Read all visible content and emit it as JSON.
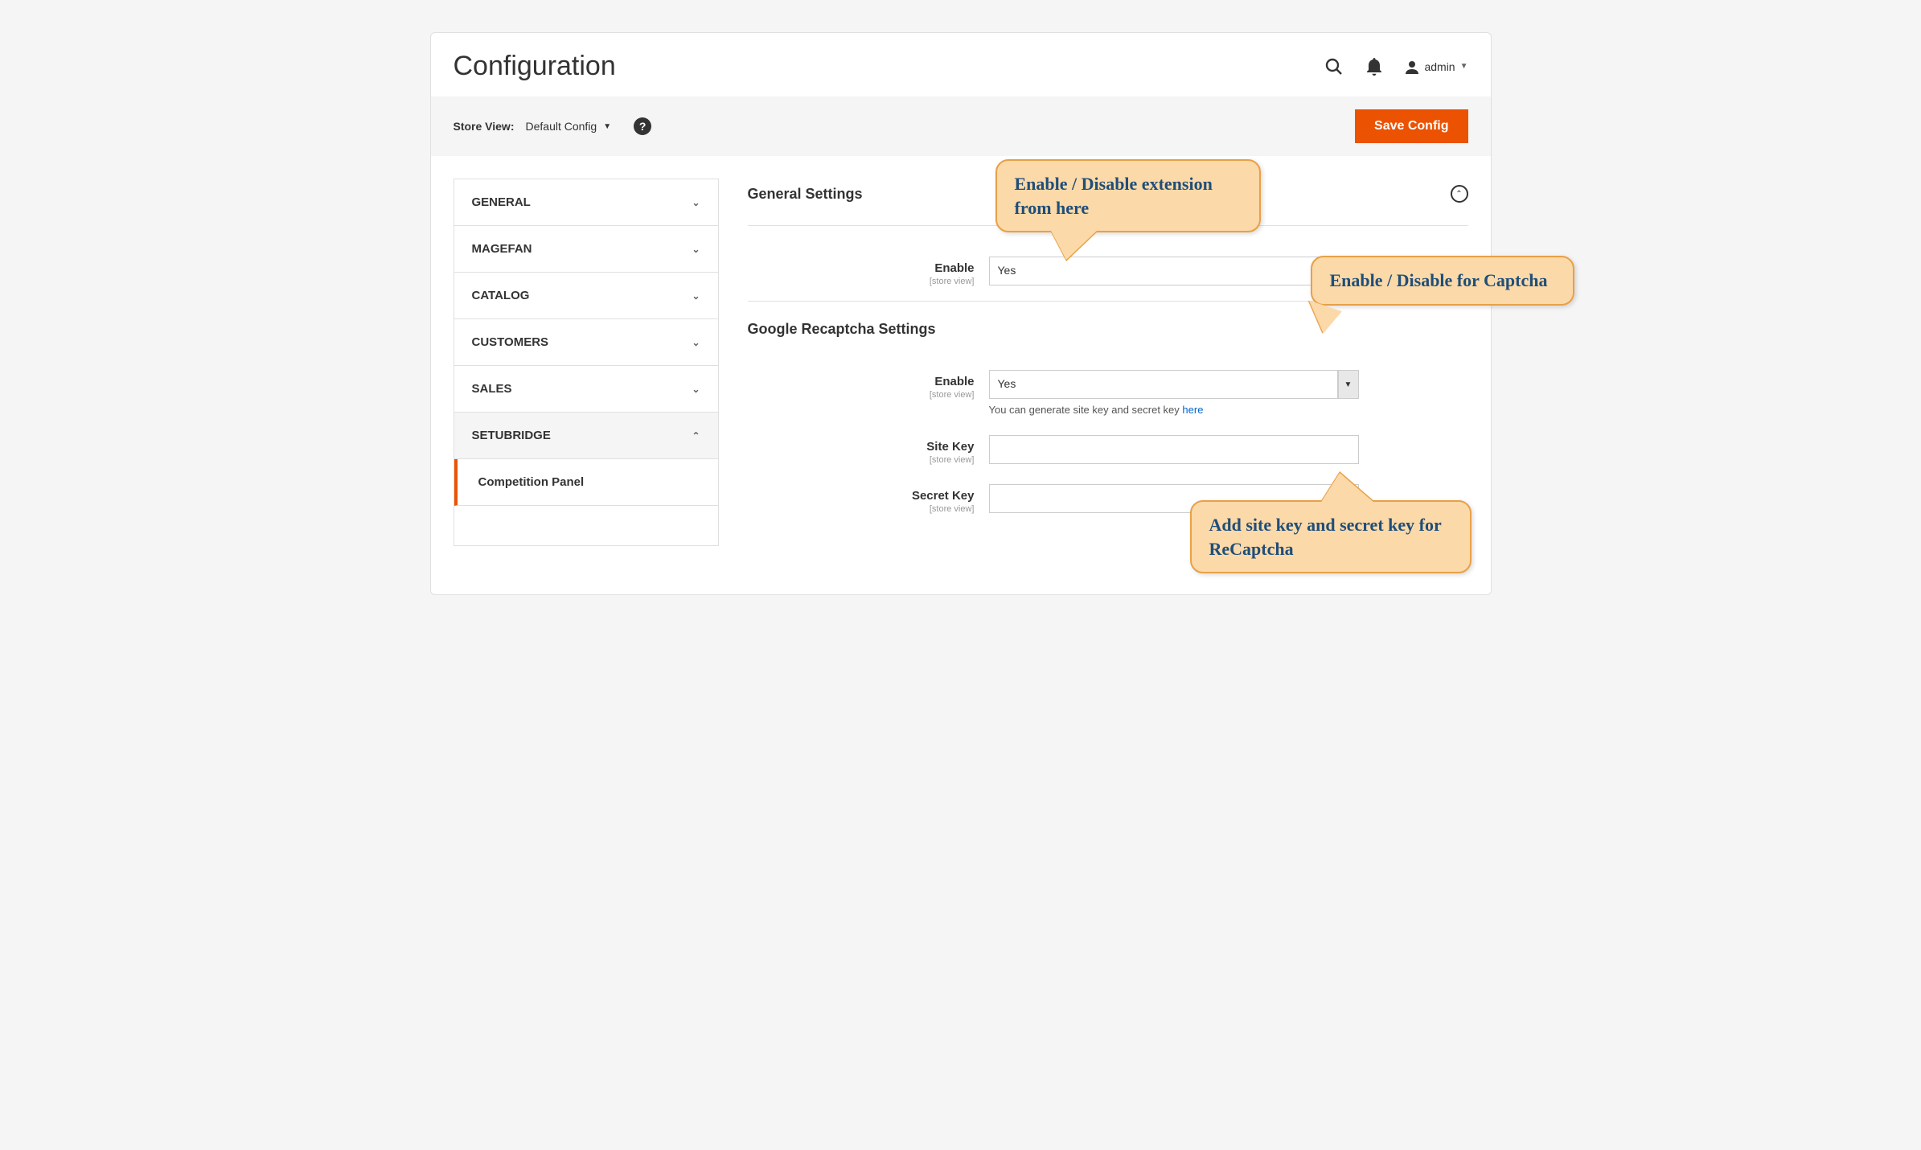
{
  "header": {
    "title": "Configuration",
    "user_label": "admin"
  },
  "storebar": {
    "label": "Store View:",
    "selected": "Default Config",
    "save_label": "Save Config"
  },
  "sidebar": {
    "items": [
      {
        "label": "GENERAL",
        "expanded": false
      },
      {
        "label": "MAGEFAN",
        "expanded": false
      },
      {
        "label": "CATALOG",
        "expanded": false
      },
      {
        "label": "CUSTOMERS",
        "expanded": false
      },
      {
        "label": "SALES",
        "expanded": false
      },
      {
        "label": "SETUBRIDGE",
        "expanded": true
      }
    ],
    "sub": "Competition Panel"
  },
  "sections": {
    "general": {
      "title": "General Settings",
      "enable": {
        "label": "Enable",
        "scope": "[store view]",
        "value": "Yes"
      }
    },
    "recaptcha": {
      "title": "Google Recaptcha Settings",
      "enable": {
        "label": "Enable",
        "scope": "[store view]",
        "value": "Yes",
        "hint_prefix": "You can generate site key and secret key ",
        "hint_link": "here"
      },
      "sitekey": {
        "label": "Site Key",
        "scope": "[store view]",
        "value": ""
      },
      "secretkey": {
        "label": "Secret Key",
        "scope": "[store view]",
        "value": ""
      }
    }
  },
  "callouts": {
    "c1": "Enable / Disable extension from here",
    "c2": "Enable / Disable for Captcha",
    "c3": "Add site key and secret key for ReCaptcha"
  }
}
